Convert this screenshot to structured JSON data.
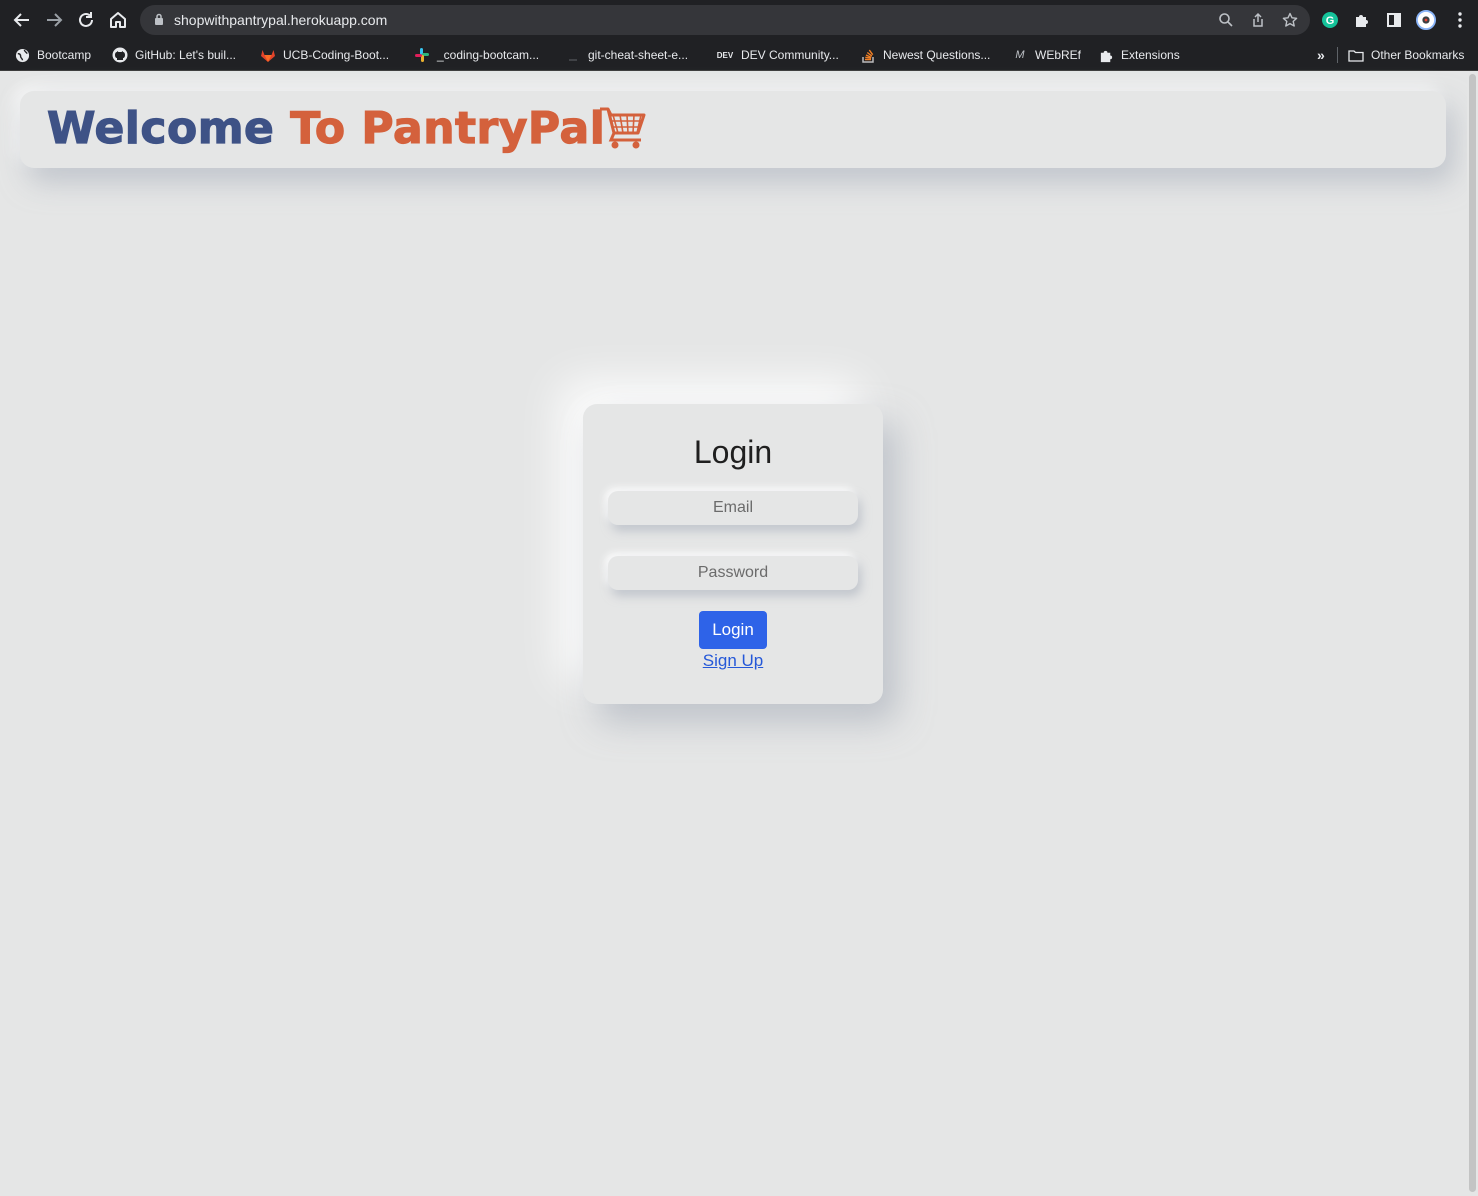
{
  "browser": {
    "url": "shopwithpantrypal.herokuapp.com",
    "bookmarks": [
      {
        "label": "Bootcamp",
        "icon": "globe-icon"
      },
      {
        "label": "GitHub: Let's buil...",
        "icon": "github-icon"
      },
      {
        "label": "UCB-Coding-Boot...",
        "icon": "gitlab-icon"
      },
      {
        "label": "_coding-bootcam...",
        "icon": "slack-icon"
      },
      {
        "label": "git-cheat-sheet-e...",
        "icon": "page-icon"
      },
      {
        "label": "DEV Community...",
        "icon": "dev-icon"
      },
      {
        "label": "Newest Questions...",
        "icon": "stackoverflow-icon"
      },
      {
        "label": "WEbREf",
        "icon": "mdn-icon"
      },
      {
        "label": "Extensions",
        "icon": "puzzle-icon"
      }
    ],
    "overflow_label": "»",
    "other_bookmarks": "Other Bookmarks",
    "extension_badge": "G"
  },
  "header": {
    "title_part1": "Welcome",
    "title_part2": "To PantryPal",
    "cart_icon": "shopping-cart-icon"
  },
  "login": {
    "heading": "Login",
    "email_placeholder": "Email",
    "password_placeholder": "Password",
    "button_label": "Login",
    "signup_link": "Sign Up"
  },
  "colors": {
    "background": "#e5e6e6",
    "title_blue": "#3e5286",
    "title_orange": "#d4613c",
    "button_blue": "#2e63e8",
    "link_blue": "#2558d8"
  }
}
